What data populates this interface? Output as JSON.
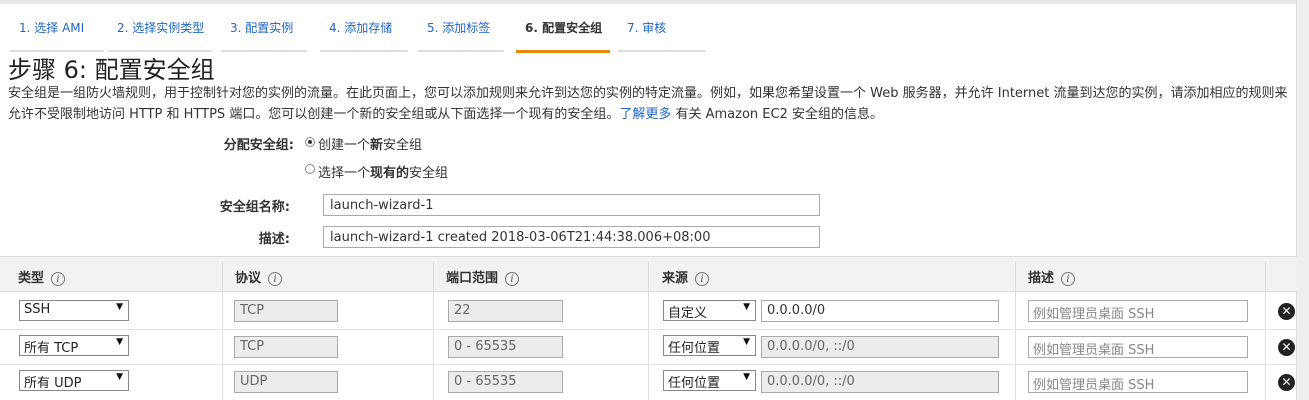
{
  "steps": [
    {
      "label": "1. 选择 AMI"
    },
    {
      "label": "2. 选择实例类型"
    },
    {
      "label": "3. 配置实例"
    },
    {
      "label": "4. 添加存储"
    },
    {
      "label": "5. 添加标签"
    },
    {
      "label": "6. 配置安全组"
    },
    {
      "label": "7. 审核"
    }
  ],
  "active_step": 6,
  "page": {
    "title": "步骤 6: 配置安全组",
    "desc_part1": "安全组是一组防火墙规则，用于控制针对您的实例的流量。在此页面上，您可以添加规则来允许到达您的实例的特定流量。例如，如果您希望设置一个 Web 服务器，并允许 Internet 流量到达您的实例，请添加相应的规则来允许不受限制地访问 HTTP 和 HTTPS 端口。您可以创建一个新的安全组或从下面选择一个现有的安全组。",
    "learn_more": "了解更多",
    "desc_part2": " 有关 Amazon EC2 安全组的信息。"
  },
  "form": {
    "assign_label": "分配安全组:",
    "option_create_pre": "创建一个",
    "option_create_bold": "新",
    "option_create_post": "安全组",
    "option_select_pre": "选择一个",
    "option_select_bold": "现有的",
    "option_select_post": "安全组",
    "name_label": "安全组名称:",
    "name_value": "launch-wizard-1",
    "desc_label": "描述:",
    "desc_value": "launch-wizard-1 created 2018-03-06T21:44:38.006+08:00"
  },
  "table": {
    "headers": {
      "type": "类型",
      "protocol": "协议",
      "port": "端口范围",
      "source": "来源",
      "description": "描述"
    },
    "info_glyph": "i",
    "delete_glyph": "✕",
    "rows": [
      {
        "type": "SSH",
        "protocol": "TCP",
        "port": "22",
        "source_type": "自定义",
        "source": "0.0.0.0/0",
        "desc_placeholder": "例如管理员桌面 SSH"
      },
      {
        "type": "所有 TCP",
        "protocol": "TCP",
        "port": "0 - 65535",
        "source_type": "任何位置",
        "source": "0.0.0.0/0, ::/0",
        "desc_placeholder": "例如管理员桌面 SSH"
      },
      {
        "type": "所有 UDP",
        "protocol": "UDP",
        "port": "0 - 65535",
        "source_type": "任何位置",
        "source": "0.0.0.0/0, ::/0",
        "desc_placeholder": "例如管理员桌面 SSH"
      }
    ]
  },
  "colors": {
    "link": "#1f66c6",
    "active_tab_underline": "#e8890c"
  }
}
